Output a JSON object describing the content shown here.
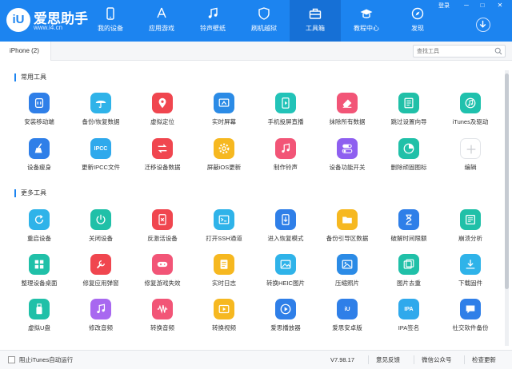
{
  "app": {
    "logo_mark": "iU",
    "name": "爱思助手",
    "url": "www.i4.cn",
    "login_label": "登录"
  },
  "nav": [
    {
      "label": "我的设备",
      "icon": "phone-icon"
    },
    {
      "label": "应用游戏",
      "icon": "app-store-icon"
    },
    {
      "label": "铃声壁纸",
      "icon": "music-note-icon"
    },
    {
      "label": "刷机越狱",
      "icon": "shield-icon"
    },
    {
      "label": "工具箱",
      "icon": "toolbox-icon",
      "active": true
    },
    {
      "label": "教程中心",
      "icon": "graduation-cap-icon"
    },
    {
      "label": "发现",
      "icon": "compass-icon"
    }
  ],
  "window_controls": [
    "─",
    "□",
    "✕"
  ],
  "tabbar": {
    "device_tab": "iPhone (2)",
    "search_placeholder": "查找工具"
  },
  "sections": {
    "common": "常用工具",
    "more": "更多工具"
  },
  "common_tools": [
    {
      "label": "安装移动端",
      "icon": "mobile-app-icon",
      "color": "#2f7fe8"
    },
    {
      "label": "备份/恢复数据",
      "icon": "umbrella-icon",
      "color": "#2fb3e9"
    },
    {
      "label": "虚拟定位",
      "icon": "location-pin-icon",
      "color": "#f0464f"
    },
    {
      "label": "实时屏幕",
      "icon": "screen-cast-icon",
      "color": "#2b8be6"
    },
    {
      "label": "手机投屏直播",
      "icon": "play-phone-icon",
      "color": "#22c3b8"
    },
    {
      "label": "抹除所有数据",
      "icon": "eraser-icon",
      "color": "#f25577"
    },
    {
      "label": "跳过设置向导",
      "icon": "guide-icon",
      "color": "#20c0a8"
    },
    {
      "label": "iTunes及驱动",
      "icon": "itunes-icon",
      "color": "#1fc1ad"
    },
    {
      "label": "设备瘦身",
      "icon": "broom-icon",
      "color": "#2f7fe8"
    },
    {
      "label": "更新IPCC文件",
      "icon": "ipcc-icon",
      "color": "#2fa9ec",
      "text": "IPCC"
    },
    {
      "label": "迁移设备数据",
      "icon": "transfer-icon",
      "color": "#f0464f"
    },
    {
      "label": "屏蔽iOS更新",
      "icon": "gear-icon",
      "color": "#f6b820"
    },
    {
      "label": "制作铃声",
      "icon": "music-note-icon",
      "color": "#f25577"
    },
    {
      "label": "设备功能开关",
      "icon": "toggle-icon",
      "color": "#8e5ff0"
    },
    {
      "label": "删除顽固图标",
      "icon": "pie-icon",
      "color": "#20c0a8"
    },
    {
      "label": "编辑",
      "icon": "plus-icon",
      "color": "#ffffff"
    }
  ],
  "more_tools": [
    {
      "label": "重启设备",
      "icon": "restart-icon",
      "color": "#2fb3e9"
    },
    {
      "label": "关闭设备",
      "icon": "power-icon",
      "color": "#20c0a8"
    },
    {
      "label": "反激活设备",
      "icon": "deactivate-icon",
      "color": "#f0464f"
    },
    {
      "label": "打开SSH通道",
      "icon": "terminal-icon",
      "color": "#2fb3e9"
    },
    {
      "label": "进入恢复模式",
      "icon": "recovery-icon",
      "color": "#2f7fe8"
    },
    {
      "label": "备份引导区数据",
      "icon": "folder-icon",
      "color": "#f6b820"
    },
    {
      "label": "破解时间限额",
      "icon": "hourglass-icon",
      "color": "#2f7fe8"
    },
    {
      "label": "崩溃分析",
      "icon": "analysis-icon",
      "color": "#20c0a8"
    },
    {
      "label": "整理设备桌面",
      "icon": "grid-icon",
      "color": "#20c0a8"
    },
    {
      "label": "修复应用弹窗",
      "icon": "repair-icon",
      "color": "#f0464f"
    },
    {
      "label": "修复游戏失效",
      "icon": "gamepad-icon",
      "color": "#f25577"
    },
    {
      "label": "实时日志",
      "icon": "log-icon",
      "color": "#f6b820"
    },
    {
      "label": "转换HEIC图片",
      "icon": "image-convert-icon",
      "color": "#2fb3e9"
    },
    {
      "label": "压缩照片",
      "icon": "photo-icon",
      "color": "#2b8be6"
    },
    {
      "label": "图片去重",
      "icon": "dedupe-icon",
      "color": "#20c0a8"
    },
    {
      "label": "下载固件",
      "icon": "download-icon",
      "color": "#2fb3e9"
    },
    {
      "label": "虚拟U盘",
      "icon": "usb-icon",
      "color": "#20c0a8"
    },
    {
      "label": "修改音频",
      "icon": "audio-edit-icon",
      "color": "#a868f0"
    },
    {
      "label": "转换音频",
      "icon": "audio-wave-icon",
      "color": "#f25577"
    },
    {
      "label": "转换视频",
      "icon": "video-convert-icon",
      "color": "#f6b820"
    },
    {
      "label": "爱思播放器",
      "icon": "player-icon",
      "color": "#2f7fe8"
    },
    {
      "label": "爱思安卓版",
      "icon": "android-icon",
      "color": "#2f7fe8",
      "text": "iU"
    },
    {
      "label": "IPA签名",
      "icon": "ipa-icon",
      "color": "#2fa9ec",
      "text": "IPA"
    },
    {
      "label": "社交软件备份",
      "icon": "chat-backup-icon",
      "color": "#2f7fe8"
    }
  ],
  "footer": {
    "itunes_auto": "阻止iTunes自动运行",
    "version": "V7.98.17",
    "feedback": "意见反馈",
    "wechat": "微信公众号",
    "update": "检查更新"
  }
}
